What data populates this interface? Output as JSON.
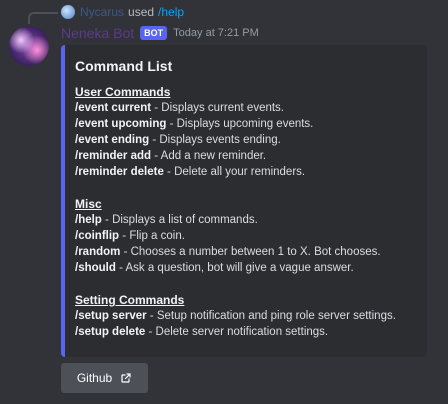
{
  "reply": {
    "username": "Nycarus",
    "action": "used",
    "command": "/help"
  },
  "message": {
    "bot_name": "Neneka Bot",
    "badge": "BOT",
    "timestamp": "Today at 7:21 PM"
  },
  "embed": {
    "title": "Command List",
    "accent_color": "#5865f2",
    "sections": [
      {
        "title": "User Commands",
        "commands": [
          {
            "name": "/event current",
            "desc": " - Displays current events."
          },
          {
            "name": "/event upcoming",
            "desc": " - Displays upcoming events."
          },
          {
            "name": "/event ending",
            "desc": " - Displays events ending."
          },
          {
            "name": "/reminder add",
            "desc": " - Add a new reminder."
          },
          {
            "name": "/reminder delete",
            "desc": " - Delete all your reminders."
          }
        ]
      },
      {
        "title": "Misc",
        "commands": [
          {
            "name": "/help",
            "desc": " - Displays a list of commands."
          },
          {
            "name": "/coinflip",
            "desc": " - Flip a coin."
          },
          {
            "name": "/random",
            "desc": " - Chooses a number between 1 to X. Bot chooses."
          },
          {
            "name": "/should",
            "desc": " - Ask a question, bot will give a vague answer."
          }
        ]
      },
      {
        "title": "Setting Commands",
        "commands": [
          {
            "name": "/setup server",
            "desc": " - Setup notification and ping role server settings."
          },
          {
            "name": "/setup delete",
            "desc": " - Delete server notification settings."
          }
        ]
      }
    ]
  },
  "button": {
    "label": "Github",
    "icon": "external-link-icon"
  }
}
